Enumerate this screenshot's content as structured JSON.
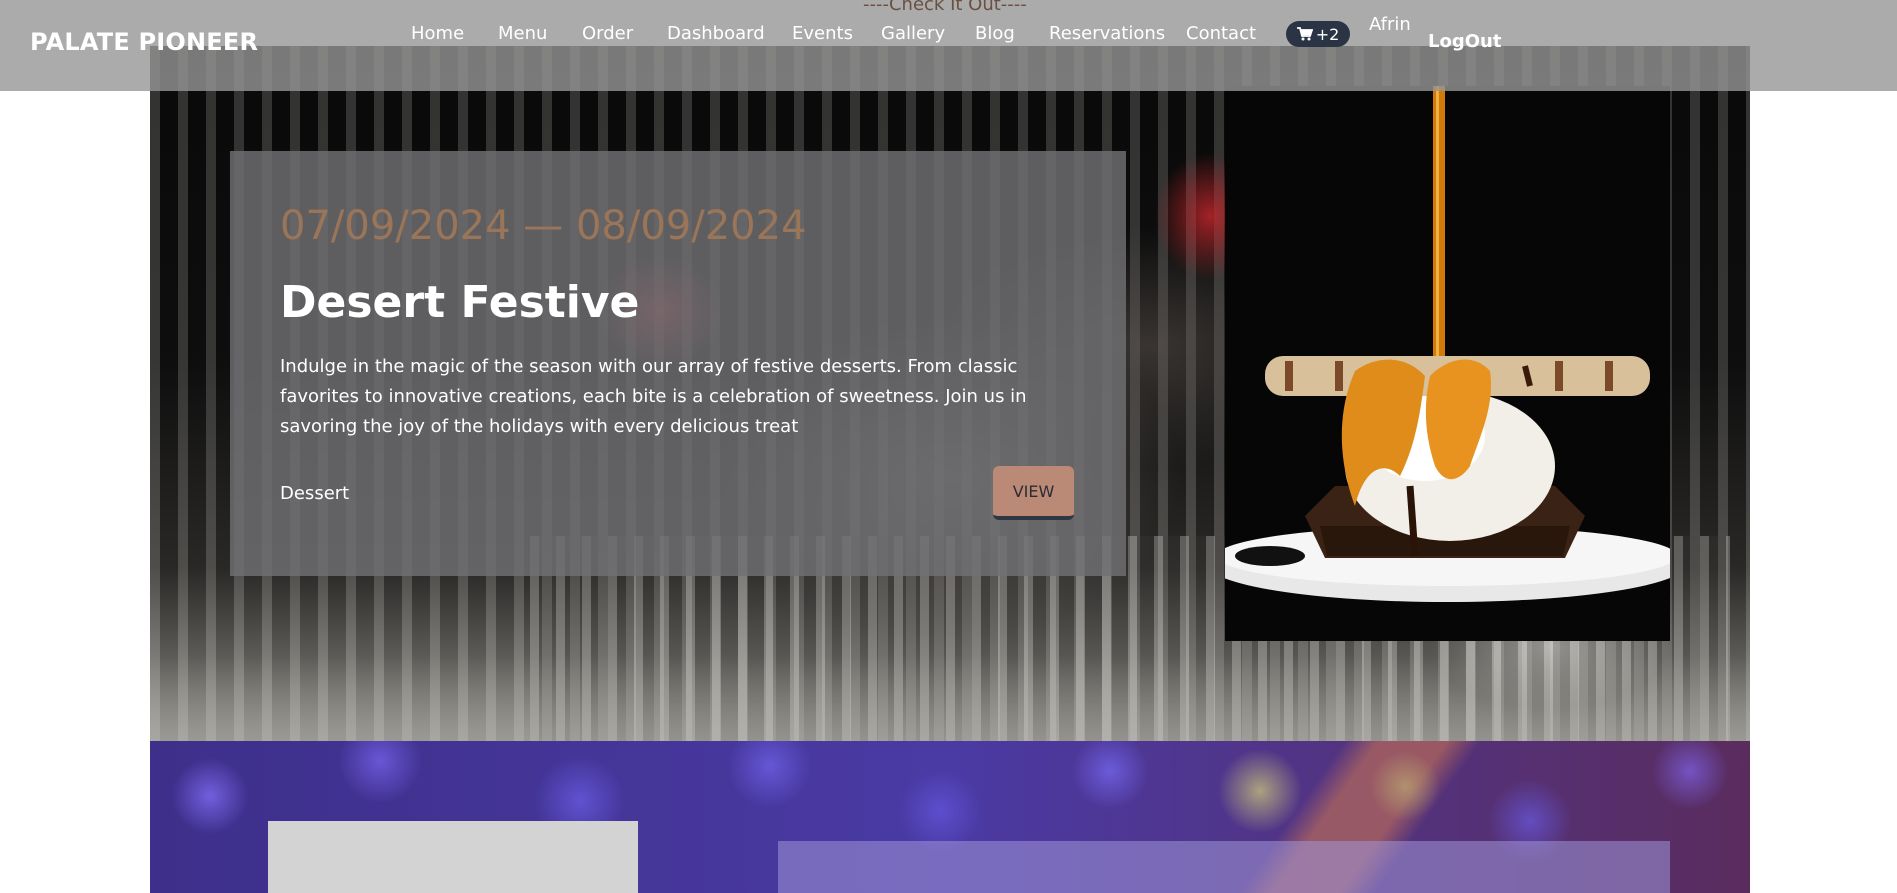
{
  "nav": {
    "brand": "PALATE PIONEER",
    "banner": "----Check It Out----",
    "items": [
      "Home",
      "Menu",
      "Order",
      "Dashboard",
      "Events",
      "Gallery",
      "Blog",
      "Reservations",
      "Contact"
    ],
    "cart_count": "+2",
    "user_name": "Afrin",
    "logout_label": "LogOut"
  },
  "event": {
    "date_range": "07/09/2024 — 08/09/2024",
    "title": "Desert Festive",
    "description": "Indulge in the magic of the season with our array of festive desserts. From classic favorites to innovative creations, each bite is a celebration of sweetness. Join us in savoring the joy of the holidays with every delicious treat",
    "category": "Dessert",
    "view_label": "VIEW"
  },
  "icons": {
    "cart": "cart-icon"
  },
  "colors": {
    "date_accent": "#9b7558",
    "view_button": "#bb8a77",
    "cart_badge": "#2b3444"
  }
}
